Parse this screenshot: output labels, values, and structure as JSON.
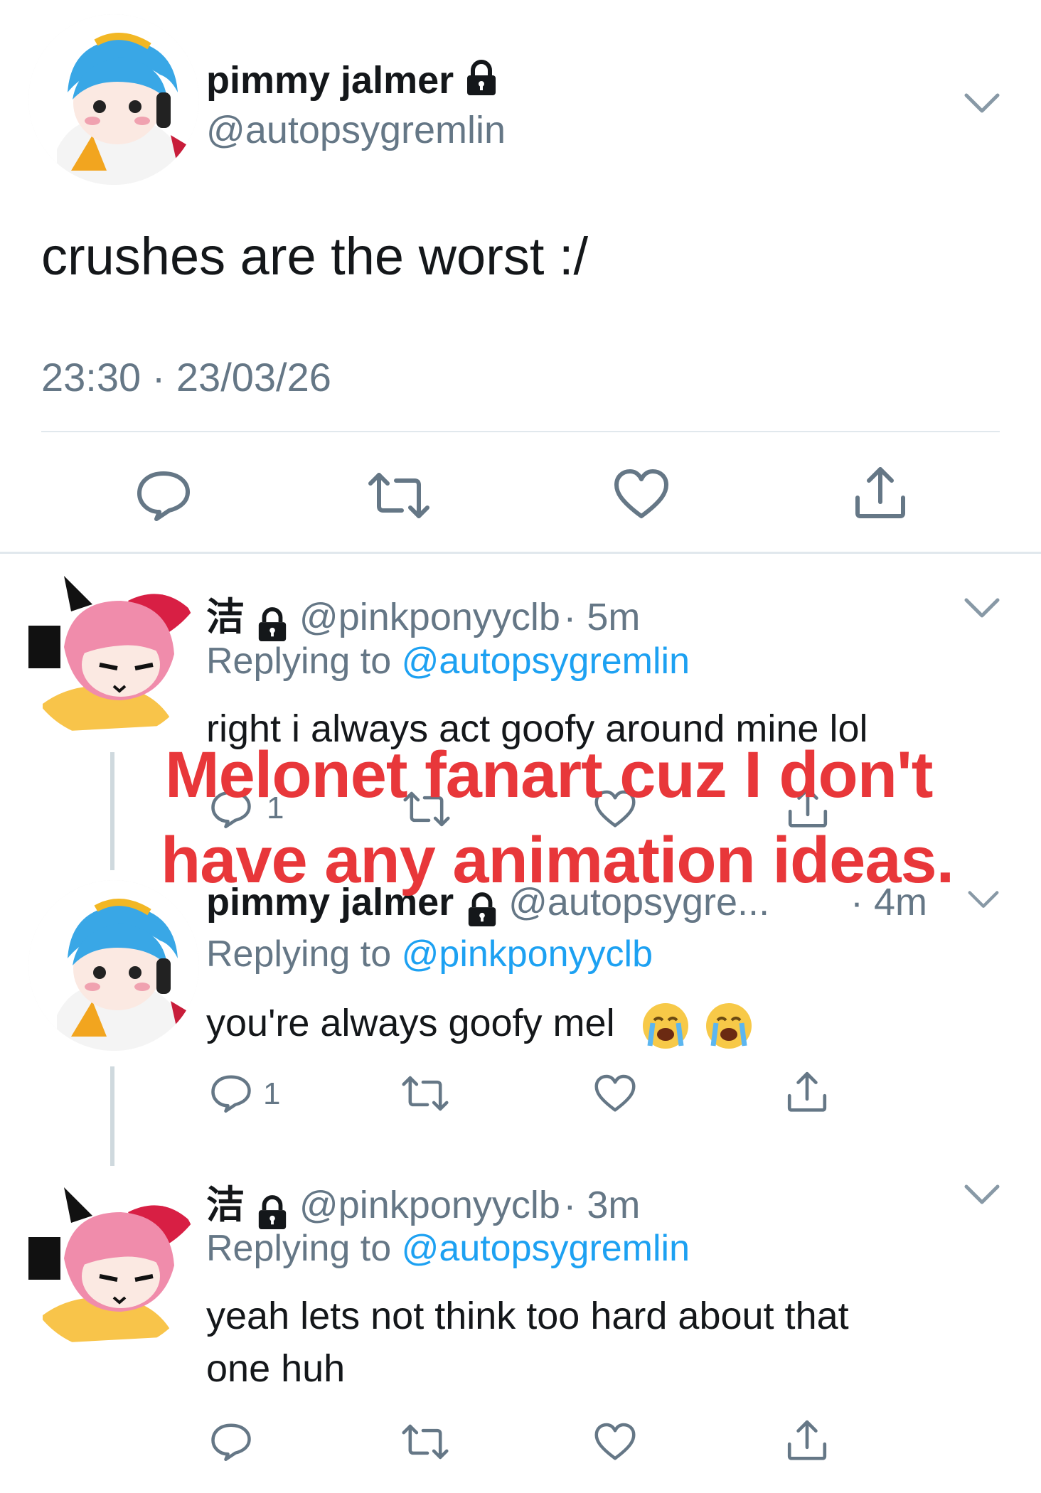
{
  "main_tweet": {
    "display_name": "pimmy jalmer",
    "handle": "@autopsygremlin",
    "text": "crushes are the worst :/",
    "timestamp": "23:30 · 23/03/26"
  },
  "replies": [
    {
      "display_name": "洁",
      "handle": "@pinkponyyclb",
      "time": "· 5m",
      "replying_prefix": "Replying to",
      "replying_to": "@autopsygremlin",
      "text": "right i always act goofy around mine lol",
      "reply_count": "1"
    },
    {
      "display_name": "pimmy jalmer",
      "handle": "@autopsygre...",
      "time": "· 4m",
      "replying_prefix": "Replying to",
      "replying_to": "@pinkponyyclb",
      "text": "you're always goofy mel",
      "reply_count": "1",
      "emojis": [
        "loudly-crying-face",
        "loudly-crying-face"
      ]
    },
    {
      "display_name": "洁",
      "handle": "@pinkponyyclb",
      "time": "· 3m",
      "replying_prefix": "Replying to",
      "replying_to": "@autopsygremlin",
      "text_line1": "yeah lets not think too hard about that",
      "text_line2": "one huh"
    }
  ],
  "overlay_caption": {
    "line1": "Melonet fanart cuz I don't",
    "line2": "have any animation ideas."
  },
  "colors": {
    "link": "#1da1f2",
    "muted": "#657786",
    "overlay_red": "#e8373a",
    "divider": "#e1e8ed"
  },
  "icons": [
    "lock-icon",
    "chevron-down-icon",
    "reply-icon",
    "retweet-icon",
    "like-icon",
    "share-icon"
  ]
}
